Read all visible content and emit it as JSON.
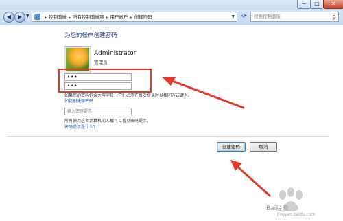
{
  "window": {
    "min_label": "─",
    "max_label": "□",
    "close_label": "✕"
  },
  "navbar": {
    "breadcrumbs": [
      "控制面板",
      "所有控制面板项",
      "用户帐户",
      "创建密码"
    ],
    "search_placeholder": "搜索控制面板"
  },
  "page": {
    "heading": "为您的帐户创建密码",
    "user_name": "Administrator",
    "user_role": "管理员",
    "new_password_value": "•••",
    "confirm_password_value": "•••",
    "caps_note": "如果您的密码包含大写字母，它们必须在每次登录时以相同方式键入。",
    "howto_link": "如何创建强密码",
    "hint_placeholder": "键入密码提示",
    "hint_note": "所有使用这台计算机的人都可以看见密码提示。",
    "whatis_link": "密码提示是什么？"
  },
  "buttons": {
    "create": "创建密码",
    "cancel": "取消"
  },
  "watermark": {
    "logo_text": "Bai经验",
    "url": "jingyan.baidu.com"
  },
  "colors": {
    "link": "#1a5bb7",
    "heading": "#1e3f8a",
    "annotation": "#e2392a"
  },
  "icons": [
    "back-icon",
    "forward-icon",
    "control-panel-icon",
    "refresh-icon",
    "search-icon",
    "user-avatar-icon"
  ]
}
